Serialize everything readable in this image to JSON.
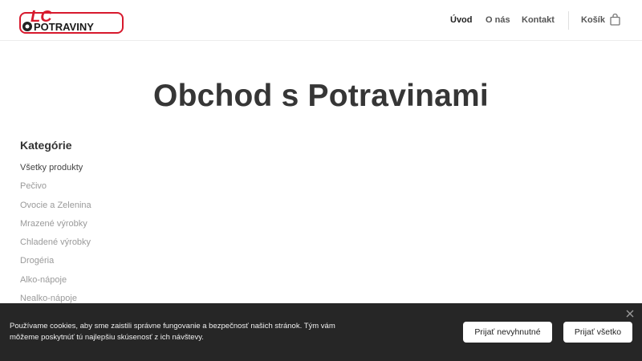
{
  "header": {
    "logo_text": "LC POTRAVINY",
    "nav": [
      {
        "label": "Úvod"
      },
      {
        "label": "O nás"
      },
      {
        "label": "Kontakt"
      }
    ],
    "cart_label": "Košík"
  },
  "main": {
    "title": "Obchod s Potravinami",
    "categories_heading": "Kategórie",
    "categories": [
      {
        "label": "Všetky produkty"
      },
      {
        "label": "Pečivo"
      },
      {
        "label": "Ovocie a Zelenina"
      },
      {
        "label": "Mrazené výrobky"
      },
      {
        "label": "Chladené výrobky"
      },
      {
        "label": "Drogéria"
      },
      {
        "label": "Alko-nápoje"
      },
      {
        "label": "Nealko-nápoje"
      }
    ]
  },
  "cookie": {
    "text": "Používame cookies, aby sme zaistili správne fungovanie a bezpečnosť našich stránok. Tým vám môžeme poskytnúť tú najlepšiu skúsenosť z ich návštevy.",
    "accept_necessary": "Prijať nevyhnutné",
    "accept_all": "Prijať všetko"
  },
  "colors": {
    "brand_red": "#d7192d",
    "cookie_bg": "#262626"
  },
  "icons": [
    "logo-icon",
    "cart-icon",
    "close-icon"
  ]
}
